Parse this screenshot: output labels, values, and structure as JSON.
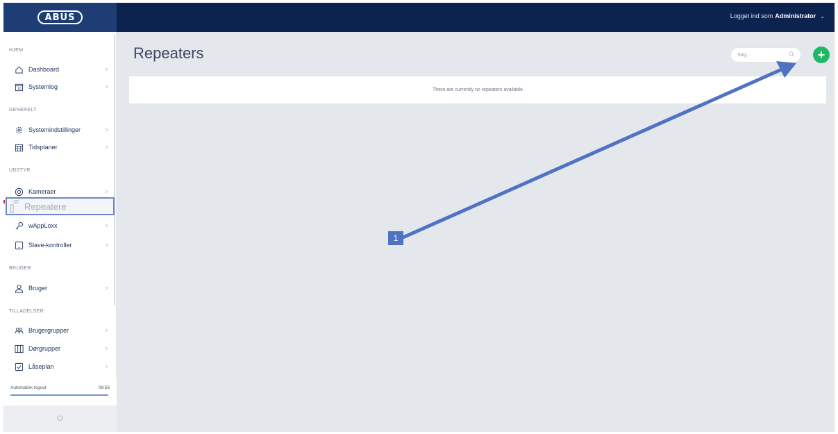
{
  "header": {
    "logo_text": "ABUS",
    "user_prefix": "Logget ind som",
    "user_name": "Administrator",
    "user_caret": "⌄"
  },
  "sidebar": {
    "sections": [
      {
        "label": "HJEM"
      },
      {
        "label": "GENERELT"
      },
      {
        "label": "UDSTYR"
      },
      {
        "label": "BRUGER"
      },
      {
        "label": "TILLADELSER"
      }
    ],
    "items": [
      {
        "label": "Dashboard",
        "icon": "home-icon"
      },
      {
        "label": "Systemlog",
        "icon": "calendar-log-icon"
      },
      {
        "label": "Systemindstillinger",
        "icon": "gear-icon"
      },
      {
        "label": "Tidsplaner",
        "icon": "schedule-icon"
      },
      {
        "label": "Kameraer",
        "icon": "camera-icon"
      },
      {
        "label": "Repeatere",
        "icon": "repeater-icon",
        "active": true
      },
      {
        "label": "wAppLoxx",
        "icon": "key-icon"
      },
      {
        "label": "Slave-kontroller",
        "icon": "tablet-icon"
      },
      {
        "label": "Bruger",
        "icon": "user-icon"
      },
      {
        "label": "Brugergrupper",
        "icon": "users-icon"
      },
      {
        "label": "Dørgrupper",
        "icon": "door-icon"
      },
      {
        "label": "Låseplan",
        "icon": "checkbox-icon"
      }
    ],
    "chevron": ">",
    "auto_logout_label": "Automatisk logout",
    "auto_logout_time": "09:56",
    "power_icon": "power-icon"
  },
  "main": {
    "title": "Repeaters",
    "search_placeholder": "Søg...",
    "add_icon": "plus-icon",
    "empty_message": "There are currently no repeaters available"
  },
  "annotation": {
    "callout_label": "1",
    "color": "#4f72c3"
  },
  "colors": {
    "topbar": "#0c2350",
    "accent_green": "#1fb864",
    "background": "#e4e7eb"
  }
}
